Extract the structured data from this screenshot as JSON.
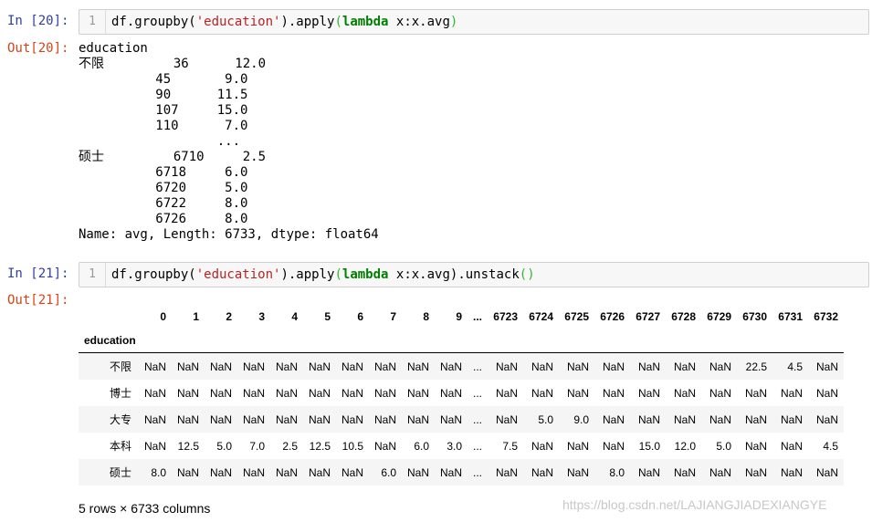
{
  "cell1": {
    "in_prompt": "In [20]:",
    "line_number": "1",
    "code": {
      "pre": "df.groupby(",
      "str": "'education'",
      "mid1": ").apply",
      "lp": "(",
      "kw": "lambda",
      "mid2": " x:x.avg",
      "rp": ")"
    },
    "out_prompt": "Out[20]:",
    "output": "education\n不限         36      12.0\n          45       9.0\n          90      11.5\n          107     15.0\n          110      7.0\n                  ...\n硕士         6710     2.5\n          6718     6.0\n          6720     5.0\n          6722     8.0\n          6726     8.0\nName: avg, Length: 6733, dtype: float64"
  },
  "cell2": {
    "in_prompt": "In [21]:",
    "line_number": "1",
    "code": {
      "pre": "df.groupby(",
      "str": "'education'",
      "mid1": ").apply",
      "lp": "(",
      "kw": "lambda",
      "mid2": " x:x.avg).unstack",
      "call": "()"
    },
    "out_prompt": "Out[21]:",
    "table": {
      "index_name": "education",
      "columns": [
        "0",
        "1",
        "2",
        "3",
        "4",
        "5",
        "6",
        "7",
        "8",
        "9",
        "...",
        "6723",
        "6724",
        "6725",
        "6726",
        "6727",
        "6728",
        "6729",
        "6730",
        "6731",
        "6732"
      ],
      "rows": [
        {
          "index": "不限",
          "values": [
            "NaN",
            "NaN",
            "NaN",
            "NaN",
            "NaN",
            "NaN",
            "NaN",
            "NaN",
            "NaN",
            "NaN",
            "...",
            "NaN",
            "NaN",
            "NaN",
            "NaN",
            "NaN",
            "NaN",
            "NaN",
            "22.5",
            "4.5",
            "NaN"
          ]
        },
        {
          "index": "博士",
          "values": [
            "NaN",
            "NaN",
            "NaN",
            "NaN",
            "NaN",
            "NaN",
            "NaN",
            "NaN",
            "NaN",
            "NaN",
            "...",
            "NaN",
            "NaN",
            "NaN",
            "NaN",
            "NaN",
            "NaN",
            "NaN",
            "NaN",
            "NaN",
            "NaN"
          ]
        },
        {
          "index": "大专",
          "values": [
            "NaN",
            "NaN",
            "NaN",
            "NaN",
            "NaN",
            "NaN",
            "NaN",
            "NaN",
            "NaN",
            "NaN",
            "...",
            "NaN",
            "5.0",
            "9.0",
            "NaN",
            "NaN",
            "NaN",
            "NaN",
            "NaN",
            "NaN",
            "NaN"
          ]
        },
        {
          "index": "本科",
          "values": [
            "NaN",
            "12.5",
            "5.0",
            "7.0",
            "2.5",
            "12.5",
            "10.5",
            "NaN",
            "6.0",
            "3.0",
            "...",
            "7.5",
            "NaN",
            "NaN",
            "NaN",
            "15.0",
            "12.0",
            "5.0",
            "NaN",
            "NaN",
            "4.5"
          ]
        },
        {
          "index": "硕士",
          "values": [
            "8.0",
            "NaN",
            "NaN",
            "NaN",
            "NaN",
            "NaN",
            "NaN",
            "6.0",
            "NaN",
            "NaN",
            "...",
            "NaN",
            "NaN",
            "NaN",
            "8.0",
            "NaN",
            "NaN",
            "NaN",
            "NaN",
            "NaN",
            "NaN"
          ]
        }
      ]
    },
    "footer": "5 rows × 6733 columns"
  },
  "watermark": "https://blog.csdn.net/LAJIANGJIADEXIANGYE",
  "colors": {
    "in_prompt": "#303f9f",
    "out_prompt": "#d84315",
    "string": "#ba2121",
    "keyword": "#008000",
    "paren": "#2fb92f"
  }
}
